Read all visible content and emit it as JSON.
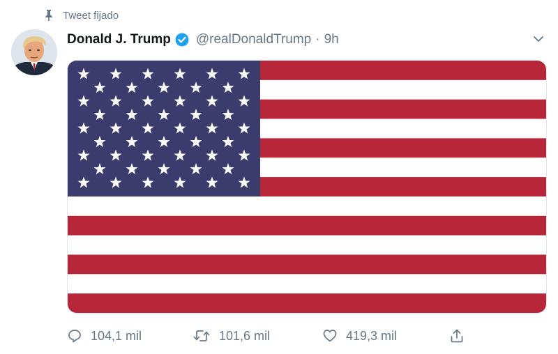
{
  "pinned": {
    "label": "Tweet fijado",
    "icon": "pin-icon"
  },
  "tweet": {
    "author_name": "Donald J. Trump",
    "verified": true,
    "handle": "@realDonaldTrump",
    "separator": "·",
    "time": "9h",
    "menu_icon": "chevron-down-icon",
    "media": {
      "description": "flag-image",
      "stripe_count": 13,
      "star_rows": 9,
      "colors": {
        "red": "#b8263a",
        "white": "#ffffff",
        "blue": "#3c3b6e",
        "star": "#ffffff"
      }
    }
  },
  "actions": {
    "reply": {
      "count": "104,1 mil",
      "icon": "reply-icon"
    },
    "retweet": {
      "count": "101,6 mil",
      "icon": "retweet-icon"
    },
    "like": {
      "count": "419,3 mil",
      "icon": "heart-icon"
    },
    "share": {
      "icon": "share-icon"
    }
  },
  "colors": {
    "text_primary": "#14171a",
    "text_secondary": "#657786",
    "verified_badge": "#1da1f2"
  }
}
